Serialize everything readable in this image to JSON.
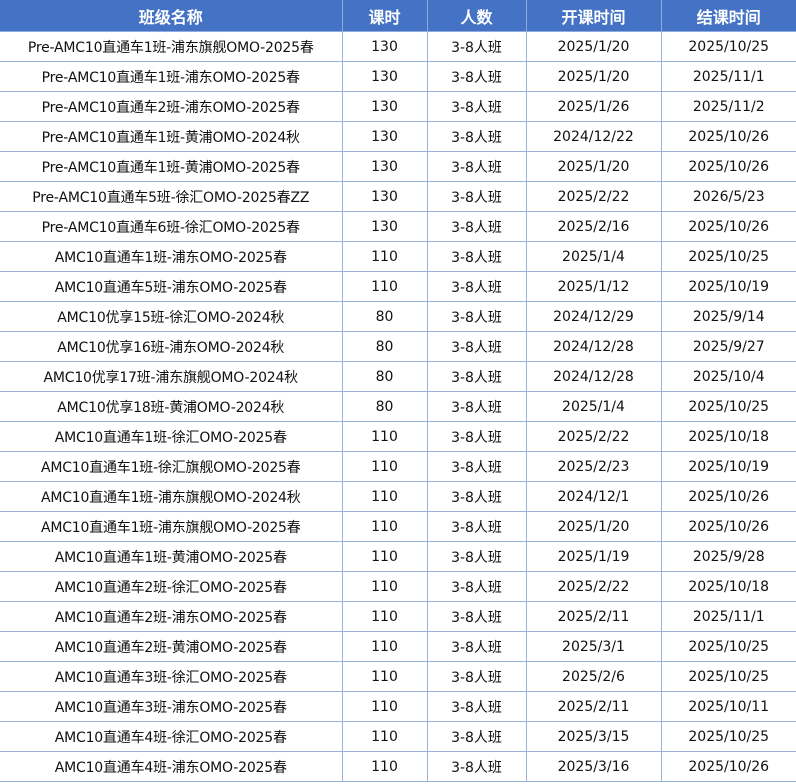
{
  "table": {
    "headers": [
      "班级名称",
      "课时",
      "人数",
      "开课时间",
      "结课时间"
    ],
    "rows": [
      [
        "Pre-AMC10直通车1班-浦东旗舰OMO-2025春",
        "130",
        "3-8人班",
        "2025/1/20",
        "2025/10/25"
      ],
      [
        "Pre-AMC10直通车1班-浦东OMO-2025春",
        "130",
        "3-8人班",
        "2025/1/20",
        "2025/11/1"
      ],
      [
        "Pre-AMC10直通车2班-浦东OMO-2025春",
        "130",
        "3-8人班",
        "2025/1/26",
        "2025/11/2"
      ],
      [
        "Pre-AMC10直通车1班-黄浦OMO-2024秋",
        "130",
        "3-8人班",
        "2024/12/22",
        "2025/10/26"
      ],
      [
        "Pre-AMC10直通车1班-黄浦OMO-2025春",
        "130",
        "3-8人班",
        "2025/1/20",
        "2025/10/26"
      ],
      [
        "Pre-AMC10直通车5班-徐汇OMO-2025春ZZ",
        "130",
        "3-8人班",
        "2025/2/22",
        "2026/5/23"
      ],
      [
        "Pre-AMC10直通车6班-徐汇OMO-2025春",
        "130",
        "3-8人班",
        "2025/2/16",
        "2025/10/26"
      ],
      [
        "AMC10直通车1班-浦东OMO-2025春",
        "110",
        "3-8人班",
        "2025/1/4",
        "2025/10/25"
      ],
      [
        "AMC10直通车5班-浦东OMO-2025春",
        "110",
        "3-8人班",
        "2025/1/12",
        "2025/10/19"
      ],
      [
        "AMC10优享15班-徐汇OMO-2024秋",
        "80",
        "3-8人班",
        "2024/12/29",
        "2025/9/14"
      ],
      [
        "AMC10优享16班-浦东OMO-2024秋",
        "80",
        "3-8人班",
        "2024/12/28",
        "2025/9/27"
      ],
      [
        "AMC10优享17班-浦东旗舰OMO-2024秋",
        "80",
        "3-8人班",
        "2024/12/28",
        "2025/10/4"
      ],
      [
        "AMC10优享18班-黄浦OMO-2024秋",
        "80",
        "3-8人班",
        "2025/1/4",
        "2025/10/25"
      ],
      [
        "AMC10直通车1班-徐汇OMO-2025春",
        "110",
        "3-8人班",
        "2025/2/22",
        "2025/10/18"
      ],
      [
        "AMC10直通车1班-徐汇旗舰OMO-2025春",
        "110",
        "3-8人班",
        "2025/2/23",
        "2025/10/19"
      ],
      [
        "AMC10直通车1班-浦东旗舰OMO-2024秋",
        "110",
        "3-8人班",
        "2024/12/1",
        "2025/10/26"
      ],
      [
        "AMC10直通车1班-浦东旗舰OMO-2025春",
        "110",
        "3-8人班",
        "2025/1/20",
        "2025/10/26"
      ],
      [
        "AMC10直通车1班-黄浦OMO-2025春",
        "110",
        "3-8人班",
        "2025/1/19",
        "2025/9/28"
      ],
      [
        "AMC10直通车2班-徐汇OMO-2025春",
        "110",
        "3-8人班",
        "2025/2/22",
        "2025/10/18"
      ],
      [
        "AMC10直通车2班-浦东OMO-2025春",
        "110",
        "3-8人班",
        "2025/2/11",
        "2025/11/1"
      ],
      [
        "AMC10直通车2班-黄浦OMO-2025春",
        "110",
        "3-8人班",
        "2025/3/1",
        "2025/10/25"
      ],
      [
        "AMC10直通车3班-徐汇OMO-2025春",
        "110",
        "3-8人班",
        "2025/2/6",
        "2025/10/25"
      ],
      [
        "AMC10直通车3班-浦东OMO-2025春",
        "110",
        "3-8人班",
        "2025/2/11",
        "2025/10/11"
      ],
      [
        "AMC10直通车4班-徐汇OMO-2025春",
        "110",
        "3-8人班",
        "2025/3/15",
        "2025/10/25"
      ],
      [
        "AMC10直通车4班-浦东OMO-2025春",
        "110",
        "3-8人班",
        "2025/3/16",
        "2025/10/26"
      ]
    ]
  }
}
